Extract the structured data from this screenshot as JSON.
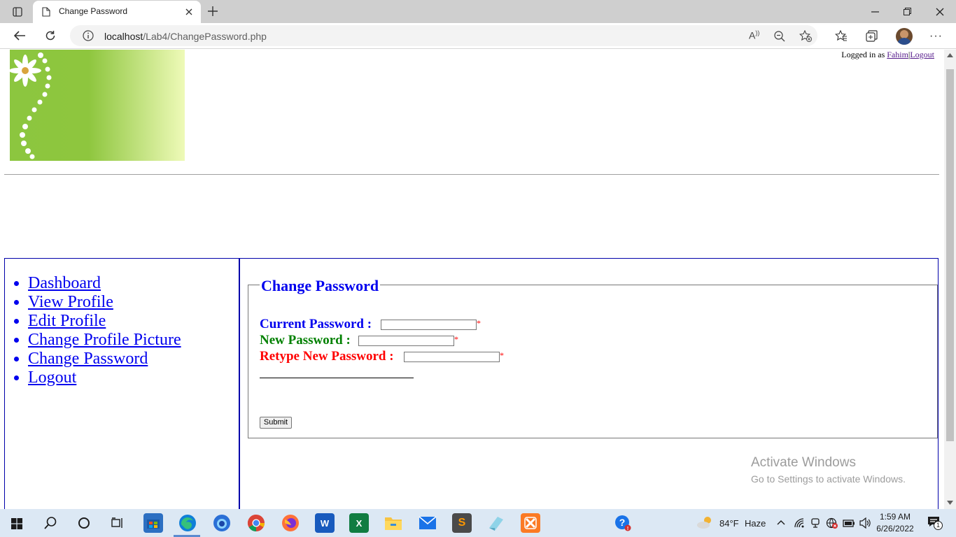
{
  "browser": {
    "tab_title": "Change Password",
    "url_host": "localhost",
    "url_path": "/Lab4/ChangePassword.php"
  },
  "header": {
    "logged_in_prefix": "Logged in as ",
    "username": "Fahim",
    "separator": "|",
    "logout_link": "Logout"
  },
  "sidebar": {
    "items": [
      {
        "label": "Dashboard"
      },
      {
        "label": "View Profile"
      },
      {
        "label": "Edit Profile"
      },
      {
        "label": "Change Profile Picture"
      },
      {
        "label": "Change Password"
      },
      {
        "label": "Logout"
      }
    ]
  },
  "form": {
    "legend": "Change Password",
    "current_label": "Current Password :",
    "new_label": "New Password :",
    "retype_label": "Retype New Password :",
    "required_mark": "*",
    "current_value": "",
    "new_value": "",
    "retype_value": "",
    "submit_label": "Submit",
    "colors": {
      "current": "#0000ee",
      "new": "#008000",
      "retype": "#ff0000"
    }
  },
  "watermark": {
    "title": "Activate Windows",
    "subtitle": "Go to Settings to activate Windows."
  },
  "taskbar": {
    "weather_temp": "84°F",
    "weather_desc": "Haze",
    "time": "1:59 AM",
    "date": "6/26/2022",
    "notification_count": "1"
  }
}
